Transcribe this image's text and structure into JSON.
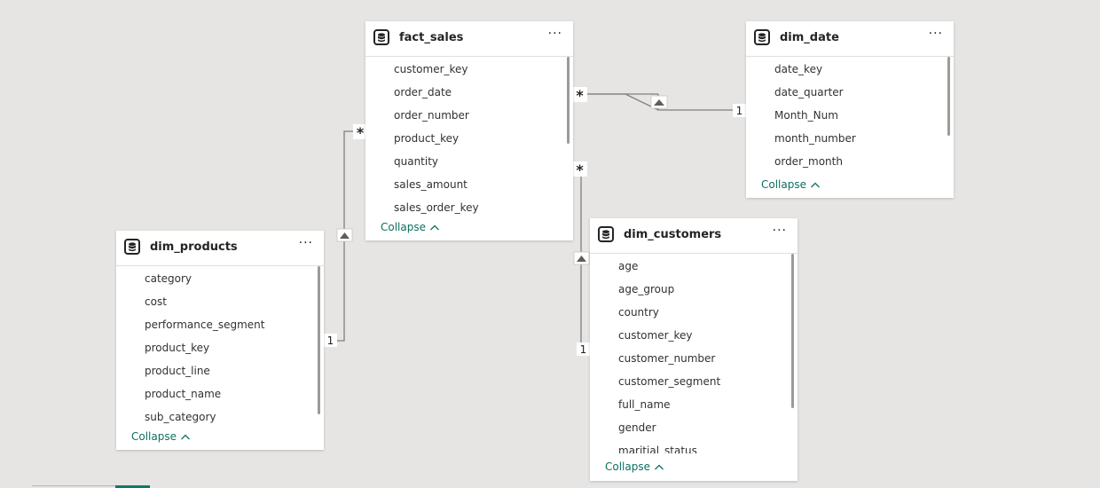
{
  "tables": {
    "fact_sales": {
      "title": "fact_sales",
      "fields": [
        "customer_key",
        "order_date",
        "order_number",
        "product_key",
        "quantity",
        "sales_amount",
        "sales_order_key"
      ],
      "collapse": "Collapse"
    },
    "dim_date": {
      "title": "dim_date",
      "fields": [
        "date_key",
        "date_quarter",
        "Month_Num",
        "month_number",
        "order_month"
      ],
      "collapse": "Collapse"
    },
    "dim_products": {
      "title": "dim_products",
      "fields": [
        "category",
        "cost",
        "performance_segment",
        "product_key",
        "product_line",
        "product_name",
        "sub_category"
      ],
      "collapse": "Collapse"
    },
    "dim_customers": {
      "title": "dim_customers",
      "fields": [
        "age",
        "age_group",
        "country",
        "customer_key",
        "customer_number",
        "customer_segment",
        "full_name",
        "gender",
        "maritial_status"
      ],
      "collapse": "Collapse"
    }
  },
  "more_label": "···",
  "collapse_icon": "chevron-up-icon",
  "table_icon": "database-icon",
  "relationships": [
    {
      "from": "dim_date",
      "to": "fact_sales",
      "one": "1",
      "many": "*"
    },
    {
      "from": "dim_products",
      "to": "fact_sales",
      "one": "1",
      "many": "*"
    },
    {
      "from": "dim_customers",
      "to": "fact_sales",
      "one": "1",
      "many": "*"
    }
  ],
  "colors": {
    "canvas": "#e6e5e4",
    "card": "#ffffff",
    "line": "#7f7e7d",
    "accent": "#0e6f62",
    "tab": "#117865"
  }
}
